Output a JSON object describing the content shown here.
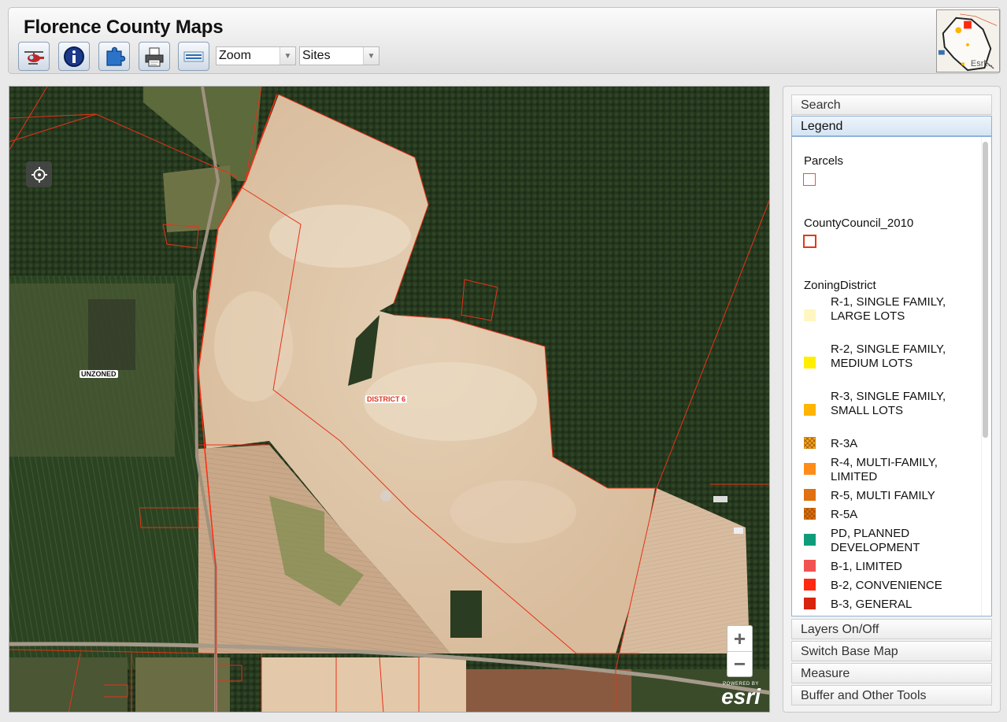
{
  "header": {
    "title": "Florence County Maps",
    "zoom_select": "Zoom",
    "sites_select": "Sites",
    "overview_label": "Esri..."
  },
  "toolbar": [
    {
      "name": "helicopter-tool-button",
      "icon": "helicopter-icon"
    },
    {
      "name": "identify-tool-button",
      "icon": "info-icon"
    },
    {
      "name": "puzzle-tool-button",
      "icon": "puzzle-icon"
    },
    {
      "name": "print-tool-button",
      "icon": "printer-icon"
    },
    {
      "name": "layers-tool-button",
      "icon": "layers-icon"
    }
  ],
  "map": {
    "labels": {
      "unzoned": "UNZONED",
      "district": "DISTRICT 6"
    },
    "zoom_in": "+",
    "zoom_out": "−",
    "attribution_powered": "POWERED BY",
    "attribution_brand": "esri"
  },
  "panel": {
    "sections": {
      "search": "Search",
      "legend": "Legend",
      "layers": "Layers On/Off",
      "basemap": "Switch Base Map",
      "measure": "Measure",
      "buffer": "Buffer and Other Tools"
    },
    "legend": {
      "layers": [
        {
          "title": "Parcels",
          "color": "#e05a3a"
        },
        {
          "title": "CountyCouncil_2010",
          "color": "#e03a1a"
        },
        {
          "title": "ZoningDistrict"
        }
      ],
      "zoning": [
        {
          "label": "R-1, SINGLE FAMILY, LARGE LOTS",
          "color": "#fff6c2",
          "hatch": false
        },
        {
          "label": "R-2, SINGLE FAMILY, MEDIUM LOTS",
          "color": "#ffee00",
          "hatch": false
        },
        {
          "label": "R-3, SINGLE FAMILY, SMALL LOTS",
          "color": "#ffb400",
          "hatch": false
        },
        {
          "label": "R-3A",
          "color": "#f3a21c",
          "hatch": true
        },
        {
          "label": "R-4, MULTI-FAMILY, LIMITED",
          "color": "#ff8c1a",
          "hatch": false
        },
        {
          "label": "R-5, MULTI FAMILY",
          "color": "#e07010",
          "hatch": false
        },
        {
          "label": "R-5A",
          "color": "#e07010",
          "hatch": true
        },
        {
          "label": "PD, PLANNED DEVELOPMENT",
          "color": "#0f9c7a",
          "hatch": false
        },
        {
          "label": "B-1, LIMITED",
          "color": "#f25252",
          "hatch": false
        },
        {
          "label": "B-2, CONVENIENCE",
          "color": "#ff2a10",
          "hatch": false
        },
        {
          "label": "B-3, GENERAL",
          "color": "#d8240c",
          "hatch": false
        }
      ]
    }
  }
}
